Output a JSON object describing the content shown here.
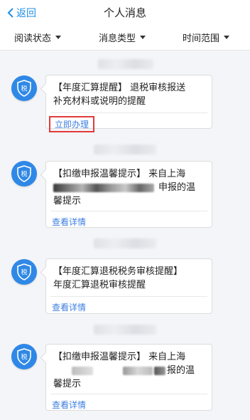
{
  "header": {
    "back_label": "返回",
    "title": "个人消息"
  },
  "filters": [
    {
      "label": "阅读状态"
    },
    {
      "label": "消息类型"
    },
    {
      "label": "时间范围"
    }
  ],
  "avatar_text": "税",
  "colors": {
    "accent": "#1f8fe5",
    "avatar_bg": "#2f88e6",
    "highlight_border": "#e23a3a",
    "link": "#3d7fe0"
  },
  "messages": [
    {
      "line1": "【年度汇算提醒】 退税审核报送",
      "line2": "补充材料或说明的提醒",
      "action": "立即办理"
    },
    {
      "line1": "【扣缴申报温馨提示】 来自上海",
      "line2": "申报的温",
      "line3": "馨提示",
      "action": "查看详情"
    },
    {
      "line1": "【年度汇算退税税务审核提醒】",
      "line2": "年度汇算退税审核提醒",
      "action": "查看详情"
    },
    {
      "line1": "【扣缴申报温馨提示】 来自上海",
      "line2": "报的温",
      "line3": "馨提示",
      "action": "查看详情"
    }
  ]
}
